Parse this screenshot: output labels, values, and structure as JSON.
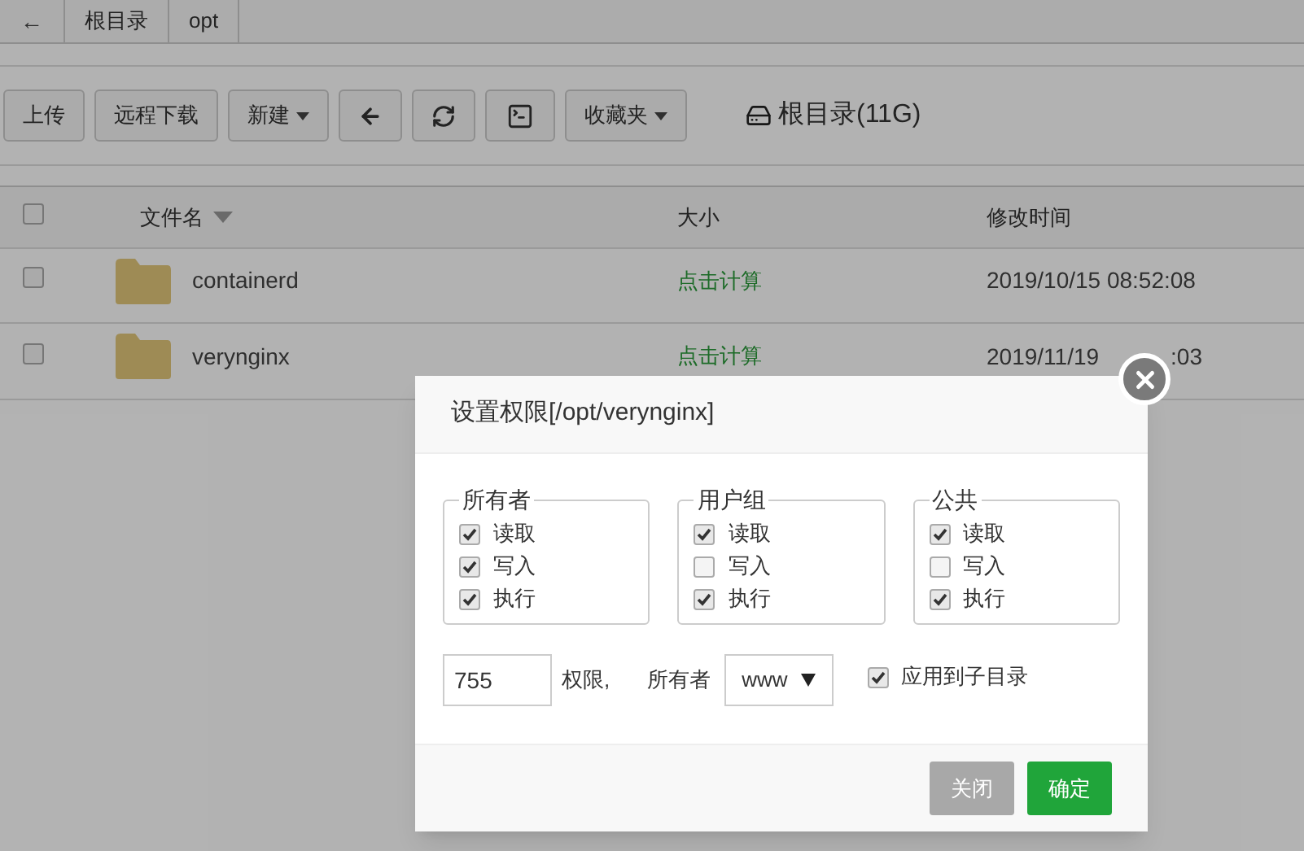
{
  "breadcrumb": {
    "back": "←",
    "items": [
      "根目录",
      "opt"
    ]
  },
  "toolbar": {
    "buttons": [
      {
        "kind": "text",
        "label": "上传"
      },
      {
        "kind": "text",
        "label": "远程下载"
      },
      {
        "kind": "dropdown",
        "label": "新建"
      },
      {
        "kind": "back"
      },
      {
        "kind": "refresh"
      },
      {
        "kind": "terminal"
      },
      {
        "kind": "dropdown",
        "label": "收藏夹"
      }
    ],
    "disk": "根目录(11G)"
  },
  "table": {
    "select_all_checked": false,
    "columns": [
      "文件名",
      "大小",
      "修改时间"
    ],
    "rows": [
      {
        "checked": false,
        "name": "containerd",
        "size": "点击计算",
        "date_start": "2019/10/15 08:52:08"
      },
      {
        "checked": false,
        "name": "verynginx",
        "size": "点击计算",
        "date_start": "2019/11/19",
        "date_end": ":03"
      }
    ]
  },
  "dialog": {
    "title": "设置权限[/opt/verynginx]",
    "groups": [
      {
        "title": "所有者",
        "options": [
          {
            "label": "读取",
            "checked": true
          },
          {
            "label": "写入",
            "checked": true
          },
          {
            "label": "执行",
            "checked": true
          }
        ]
      },
      {
        "title": "用户组",
        "options": [
          {
            "label": "读取",
            "checked": true
          },
          {
            "label": "写入",
            "checked": false
          },
          {
            "label": "执行",
            "checked": true
          }
        ]
      },
      {
        "title": "公共",
        "options": [
          {
            "label": "读取",
            "checked": true
          },
          {
            "label": "写入",
            "checked": false
          },
          {
            "label": "执行",
            "checked": true
          }
        ]
      }
    ],
    "mode": "755",
    "mode_label": "权限,",
    "owner_label": "所有者",
    "owner": "www",
    "recursive": {
      "label": "应用到子目录",
      "checked": true
    },
    "buttons": [
      {
        "label": "关闭",
        "primary": false
      },
      {
        "label": "确定",
        "primary": true
      }
    ]
  }
}
